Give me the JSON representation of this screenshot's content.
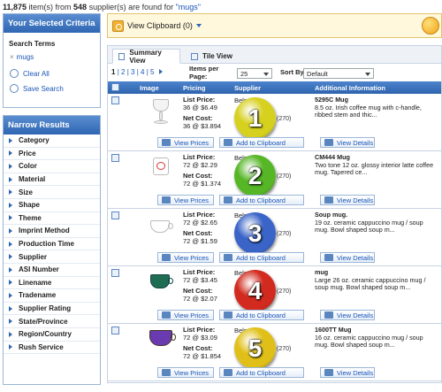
{
  "summary": {
    "count": "11,875",
    "mid": " item(s) from ",
    "suppliers": "548",
    "tail": " supplier(s) are found for ",
    "query": "\"mugs\""
  },
  "sidebar": {
    "criteria_title": "Your Selected Criteria",
    "search_terms_label": "Search Terms",
    "term_x": "×",
    "term": "mugs",
    "clear_all": "Clear All",
    "save_search": "Save Search",
    "narrow_title": "Narrow Results",
    "filters": [
      "Category",
      "Price",
      "Color",
      "Material",
      "Size",
      "Shape",
      "Theme",
      "Imprint Method",
      "Production Time",
      "Supplier",
      "ASI Number",
      "Linename",
      "Tradename",
      "Supplier Rating",
      "State/Province",
      "Region/Country",
      "Rush Service"
    ]
  },
  "clipboard": {
    "label": "View Clipboard (0)"
  },
  "tabs": {
    "summary": "Summary View",
    "tile": "Tile View"
  },
  "pager": {
    "p1": "1",
    "p2": "2",
    "p3": "3",
    "p4": "4",
    "p5": "5",
    "sep": "|"
  },
  "controls": {
    "ipp_label": "Items per Page:",
    "ipp_value": "25",
    "sort_label": "Sort By:",
    "sort_value": "Default"
  },
  "columns": {
    "image": "Image",
    "pricing": "Pricing",
    "supplier": "Supplier",
    "info": "Additional Information"
  },
  "buttons": {
    "view_prices": "View Prices",
    "add_clip": "Add to Clipboard",
    "view_details": "View Details"
  },
  "colors": {
    "accent": "#2f66b3",
    "link": "#1a56b8",
    "stars": "#f0a316"
  },
  "results": [
    {
      "n": "1",
      "list_label": "List Price:",
      "list": "36 @ $6.49",
      "net_label": "Net Cost:",
      "net": "36 @ $3.894",
      "supplier": "Belpr",
      "rev": "(270)",
      "sku": "5295C",
      "name": "Mug",
      "desc": "8.5 oz. Irish coffee mug with c-handle, ribbed stem and thic...",
      "ball": "#d6d01e"
    },
    {
      "n": "2",
      "list_label": "List Price:",
      "list": "72 @ $2.29",
      "net_label": "Net Cost:",
      "net": "72 @ $1.374",
      "supplier": "Belpr",
      "rev": "(270)",
      "sku": "CM444",
      "name": "Mug",
      "desc": "Two tone 12 oz. glossy interior latte coffee mug. Tapered ce...",
      "ball": "#56b626"
    },
    {
      "n": "3",
      "list_label": "List Price:",
      "list": "72 @ $2.65",
      "net_label": "Net Cost:",
      "net": "72 @ $1.59",
      "supplier": "Belpr",
      "rev": "(270)",
      "sku": "",
      "name": "Soup mug.",
      "desc": "19 oz. ceramic cappuccino mug / soup mug. Bowl shaped soup m...",
      "ball": "#3a64c8"
    },
    {
      "n": "4",
      "list_label": "List Price:",
      "list": "72 @ $3.45",
      "net_label": "Net Cost:",
      "net": "72 @ $2.07",
      "supplier": "Belpr",
      "rev": "(270)",
      "sku": "",
      "name": "mug",
      "desc": "Large 26 oz. ceramic cappuccino mug / soup mug. Bowl shaped soup m...",
      "ball": "#d22a1f"
    },
    {
      "n": "5",
      "list_label": "List Price:",
      "list": "72 @ $3.09",
      "net_label": "Net Cost:",
      "net": "72 @ $1.854",
      "supplier": "Belpromo",
      "rev": "(270)",
      "sku": "1600TT",
      "name": "Mug",
      "desc": "16 oz. ceramic cappuccino mug / soup mug. Bowl shaped soup m...",
      "ball": "#e0c018"
    }
  ]
}
